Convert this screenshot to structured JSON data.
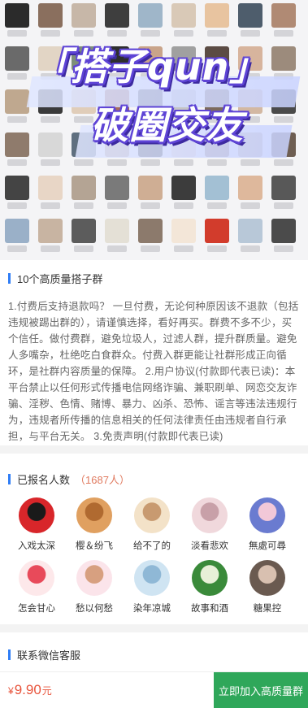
{
  "hero": {
    "title_line1": "「搭子qun」",
    "title_line2": "破圈交友",
    "grid_colors": [
      "#2b2b2b",
      "#8a6f5e",
      "#c7b7a8",
      "#3e3e3e",
      "#9fb6c9",
      "#d9c9b7",
      "#e8c4a0",
      "#4e5d6c",
      "#b08a74",
      "#6a6a6a",
      "#e2d5c5",
      "#7e8f7a",
      "#2e2e2e",
      "#c9a48a",
      "#a0a0a0",
      "#5b4b44",
      "#d7b49d",
      "#9c8b7c",
      "#bfa88f",
      "#3a3a3a",
      "#e0cdb9",
      "#a86c57",
      "#555555",
      "#c4c4c4",
      "#7c6a5c",
      "#d3b8a2",
      "#4a4a4a",
      "#8f7b6c",
      "#d8d8d8",
      "#5f6f7f",
      "#b89c86",
      "#2c2c2c",
      "#e6d2c0",
      "#9a8070",
      "#c2b2a2",
      "#6e5e52",
      "#444444",
      "#e8d6c6",
      "#b4a494",
      "#7a7a7a",
      "#cfae94",
      "#3c3c3c",
      "#a3c0d4",
      "#deb89c",
      "#585858",
      "#9ab0c8",
      "#c8b4a2",
      "#5c5c5c",
      "#e4e0d6",
      "#8c7a6c",
      "#f3e6d8",
      "#d23c2c",
      "#b8c8d8",
      "#4b4b4b",
      "#cccccc",
      "#3b3b3b",
      "#c9b9a8",
      "#f2c44c",
      "#7e9a7a",
      "#d9cbb9",
      "#a6b6c0",
      "#c6a88e",
      "#343434",
      "#bba593",
      "#6c6c6c",
      "#d0c0ae",
      "#2a2a2a",
      "#e2c8b0",
      "#8a8a8a",
      "#c0b0a0",
      "#4d4d4d",
      "#b39b86"
    ]
  },
  "rules": {
    "heading": "10个高质量搭子群",
    "body": "1.付费后支持退款吗？ 一旦付费，无论何种原因该不退款（包括违规被踢出群的），请谨慎选择，看好再买。群费不多不少，买个信任。做付费群，避免垃圾人，过滤人群，提升群质量。避免人多嘴杂，杜绝吃白食群众。付费入群更能让社群形成正向循环，是社群内容质量的保障。 2.用户协议(付款即代表已读)：本平台禁止以任何形式传播电信网络诈骗、兼职刷单、网恋交友诈骗、淫秽、色情、赌博、暴力、凶杀、恐怖、谣言等违法违规行为，违规者所传播的信息相关的任何法律责任由违规者自行承担，与平台无关。 3.免责声明(付款即代表已读)"
  },
  "members": {
    "heading": "已报名人数",
    "count": "（1687人）",
    "list": [
      {
        "name": "入戏太深",
        "c1": "#d8262a",
        "c2": "#1a1a1a"
      },
      {
        "name": "樱＆纷飞",
        "c1": "#e0a060",
        "c2": "#b06a30"
      },
      {
        "name": "给不了的",
        "c1": "#f3e2c8",
        "c2": "#c89a70"
      },
      {
        "name": "淡看悲欢",
        "c1": "#f0d8dc",
        "c2": "#c8a0a8"
      },
      {
        "name": "無處可尋",
        "c1": "#6a7bd0",
        "c2": "#f2c8d8"
      },
      {
        "name": "怎会甘心",
        "c1": "#fde8ea",
        "c2": "#e84a5a"
      },
      {
        "name": "愁以何愁",
        "c1": "#fbe4ea",
        "c2": "#d7a080"
      },
      {
        "name": "染年凉城",
        "c1": "#cfe4f2",
        "c2": "#8fb8d6"
      },
      {
        "name": "故事和酒",
        "c1": "#3a8a3a",
        "c2": "#e8f0d8"
      },
      {
        "name": "糖果控",
        "c1": "#6a5a50",
        "c2": "#d8c0b0"
      }
    ]
  },
  "service": {
    "heading": "联系微信客服"
  },
  "bottom": {
    "currency": "¥",
    "price": "9.90",
    "unit": "元",
    "join_label": "立即加入高质量群"
  }
}
